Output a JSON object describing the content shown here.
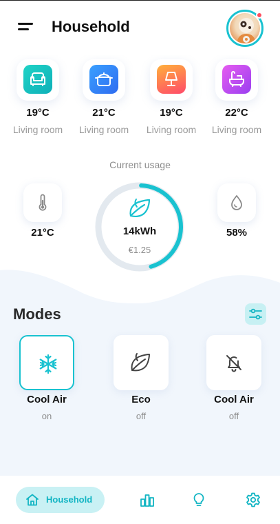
{
  "header": {
    "title": "Household",
    "menu_icon": "hamburger-menu-icon",
    "avatar": "user-avatar",
    "notification_color": "#ff4d5e"
  },
  "rooms": [
    {
      "icon": "sofa-icon",
      "temp": "19°C",
      "name": "Living room",
      "color_from": "#1fd3c6",
      "color_to": "#0fb0b8"
    },
    {
      "icon": "pot-icon",
      "temp": "21°C",
      "name": "Living room",
      "color_from": "#3aa0ff",
      "color_to": "#2f6cf0"
    },
    {
      "icon": "lamp-icon",
      "temp": "19°C",
      "name": "Living room",
      "color_from": "#ff9a3c",
      "color_to": "#ff4a6a"
    },
    {
      "icon": "bathtub-icon",
      "temp": "22°C",
      "name": "Living room",
      "color_from": "#e65cf0",
      "color_to": "#9a3ff0"
    }
  ],
  "usage": {
    "label": "Current usage",
    "energy": "14kWh",
    "cost": "€1.25",
    "progress": 0.45,
    "temperature": "21°C",
    "humidity": "58%"
  },
  "modes": {
    "title": "Modes",
    "items": [
      {
        "icon": "snowflake-icon",
        "name": "Cool Air",
        "state": "on"
      },
      {
        "icon": "leaf-icon",
        "name": "Eco",
        "state": "off"
      },
      {
        "icon": "bell-off-icon",
        "name": "Cool Air",
        "state": "off"
      }
    ]
  },
  "nav": {
    "home_label": "Household",
    "items": [
      "home-icon",
      "chart-bars-icon",
      "lightbulb-icon",
      "settings-gear-icon"
    ]
  },
  "colors": {
    "accent": "#19c2d0",
    "accent_light": "#c9f1f4",
    "background_light": "#f1f6fc"
  }
}
